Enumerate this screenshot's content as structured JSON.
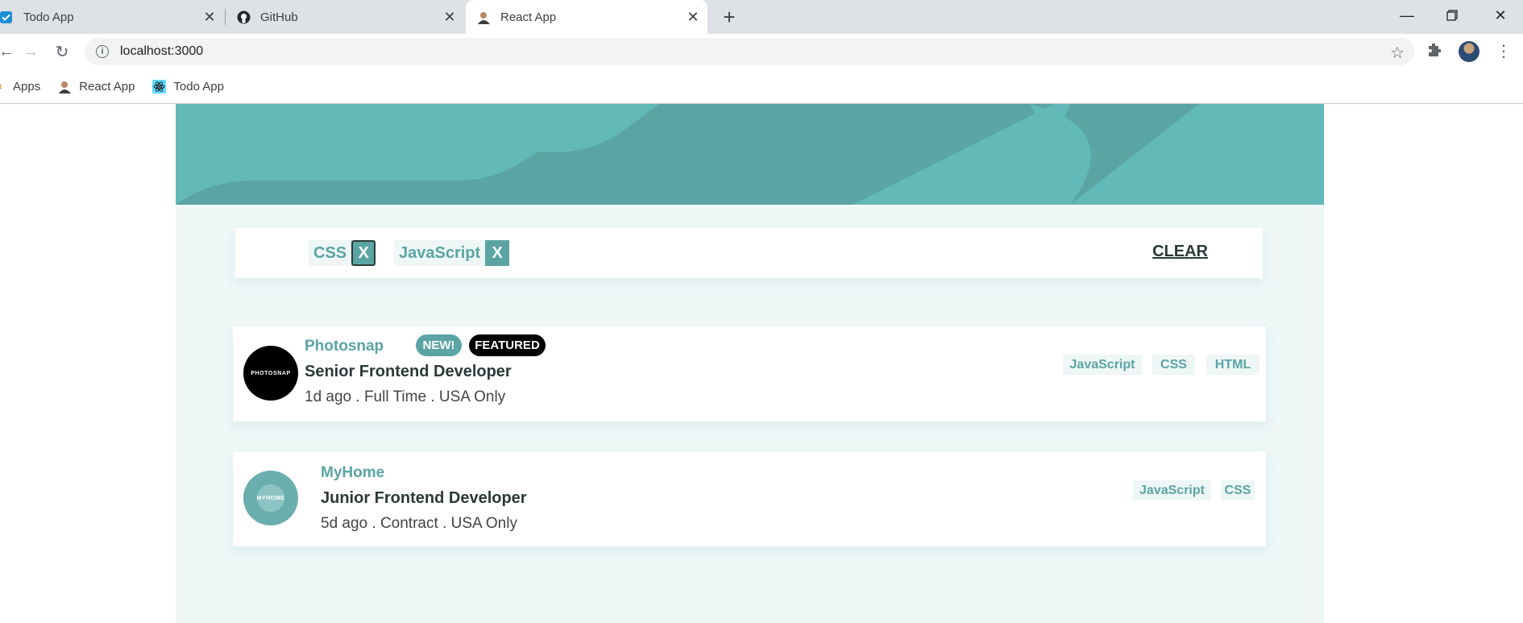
{
  "browser": {
    "tabs": [
      {
        "title": "Todo App"
      },
      {
        "title": "GitHub"
      },
      {
        "title": "React App"
      }
    ],
    "url": "localhost:3000",
    "bookmarks": [
      {
        "label": "Apps"
      },
      {
        "label": "React App"
      },
      {
        "label": "Todo App"
      }
    ]
  },
  "filters": {
    "chips": [
      {
        "label": "CSS",
        "remove": "X"
      },
      {
        "label": "JavaScript",
        "remove": "X"
      }
    ],
    "clear_label": "CLEAR"
  },
  "jobs": [
    {
      "logo_text": "PHOTOSNAP",
      "company": "Photosnap",
      "new_label": "NEW!",
      "featured_label": "FEATURED",
      "position": "Senior Frontend Developer",
      "meta": "1d ago . Full Time . USA Only",
      "tags": [
        "JavaScript",
        "CSS",
        "HTML"
      ]
    },
    {
      "logo_text": "MYHOME",
      "company": "MyHome",
      "position": "Junior Frontend Developer",
      "meta": "5d ago . Contract . USA Only",
      "tags": [
        "JavaScript",
        "CSS"
      ]
    }
  ],
  "colors": {
    "primary": "#5ba4a4",
    "hero": "#63b8b8",
    "page_bg": "#eff7f7",
    "tag_bg": "#eef6f6",
    "dark": "#2b3939"
  }
}
